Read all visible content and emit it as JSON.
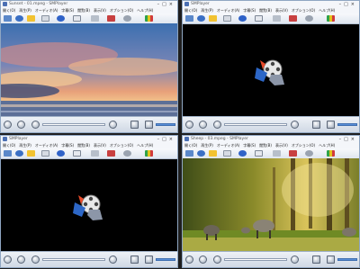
{
  "windows": [
    {
      "title": "Sunset - 01.mpeg - SMPlayer",
      "menu": [
        "開く(O)",
        "再生(P)",
        "オーディオ(A)",
        "字幕(S)",
        "閲覧(B)",
        "表示(V)",
        "オプション(O)",
        "ヘルプ(H)"
      ],
      "content": "video-sunset"
    },
    {
      "title": "SMPlayer",
      "menu": [
        "開く(O)",
        "再生(P)",
        "オーディオ(A)",
        "字幕(S)",
        "閲覧(B)",
        "表示(V)",
        "オプション(O)",
        "ヘルプ(H)"
      ],
      "content": "logo"
    },
    {
      "title": "SMPlayer",
      "menu": [
        "開く(O)",
        "再生(P)",
        "オーディオ(A)",
        "字幕(S)",
        "閲覧(B)",
        "表示(V)",
        "オプション(O)",
        "ヘルプ(H)"
      ],
      "content": "logo"
    },
    {
      "title": "Sheep - 03.mpeg - SMPlayer",
      "menu": [
        "開く(O)",
        "再生(P)",
        "オーディオ(A)",
        "字幕(S)",
        "閲覧(B)",
        "表示(V)",
        "オプション(O)",
        "ヘルプ(H)"
      ],
      "content": "video-sheep"
    }
  ],
  "icons": {
    "toolbar": [
      "open-file-icon",
      "globe-icon",
      "star-icon",
      "playlist-icon",
      "info-icon",
      "subtitle-icon",
      "tools-icon",
      "scissors-icon",
      "settings-icon",
      "equalizer-icon"
    ],
    "controls": [
      "play-pause-icon",
      "stop-icon",
      "rewind-icon",
      "forward-icon",
      "fullscreen-icon",
      "volume-icon"
    ]
  },
  "colors": {
    "accent": "#4b6fb3",
    "volume": "#5a8fd8",
    "frame": "#8fa6c2"
  }
}
